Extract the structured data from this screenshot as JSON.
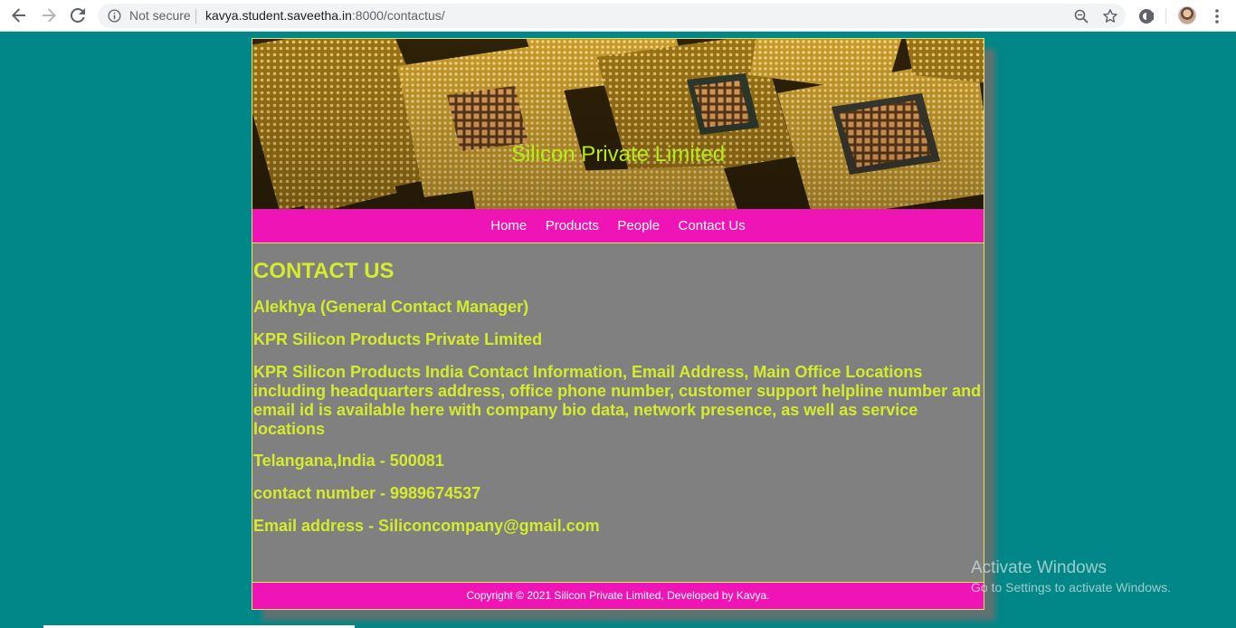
{
  "browser": {
    "security_label": "Not secure",
    "url_host": "kavya.student.saveetha.in",
    "url_rest": ":8000/contactus/",
    "icons": {
      "back": "back-arrow-icon",
      "forward": "forward-arrow-icon",
      "reload": "reload-icon",
      "info": "info-icon",
      "zoom": "zoom-icon",
      "bookmark": "star-icon",
      "extension": "extension-icon",
      "profile": "avatar",
      "menu": "kebab-menu-icon"
    }
  },
  "site": {
    "title": "Silicon Private Limited",
    "nav": [
      {
        "label": "Home"
      },
      {
        "label": "Products"
      },
      {
        "label": "People"
      },
      {
        "label": "Contact Us"
      }
    ],
    "colors": {
      "background": "#018787",
      "nav_bg": "#ef14b6",
      "text_accent": "#d4ec2c",
      "content_bg": "#808080"
    }
  },
  "contact": {
    "heading": "CONTACT US",
    "lines": [
      "Alekhya (General Contact Manager)",
      "KPR Silicon Products Private Limited",
      "KPR Silicon Products India Contact Information, Email Address, Main Office Locations including headquarters address, office phone number, customer support helpline number and email id is available here with company bio data, network presence, as well as service locations",
      "Telangana,India - 500081",
      "contact number - 9989674537",
      "Email address - Siliconcompany@gmail.com"
    ]
  },
  "footer": {
    "text": "Copyright © 2021 Silicon Private Limited, Developed by Kavya."
  },
  "os": {
    "watermark_title": "Activate Windows",
    "watermark_sub": "Go to Settings to activate Windows."
  }
}
